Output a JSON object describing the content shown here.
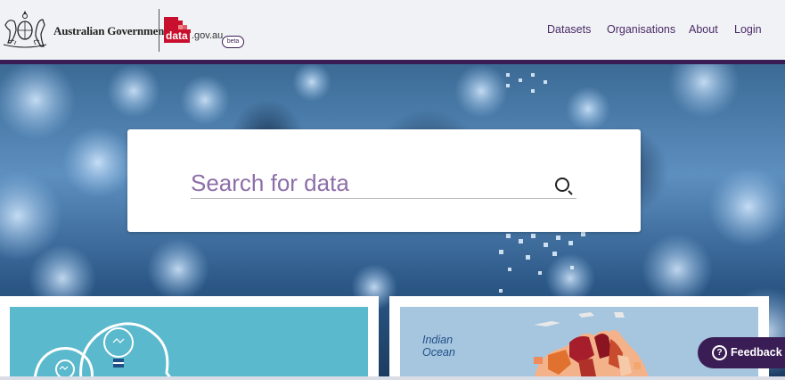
{
  "header": {
    "government_label": "Australian Government",
    "logo": {
      "data_text": "data",
      "domain_text": ".gov.au",
      "badge": "beta",
      "brand_color": "#c8102e"
    },
    "nav": [
      {
        "label": "Datasets"
      },
      {
        "label": "Organisations"
      },
      {
        "label": "About"
      },
      {
        "label": "Login"
      }
    ],
    "accent_color": "#3a1d54"
  },
  "search": {
    "placeholder": "Search for data",
    "value": "",
    "icon": "search-icon"
  },
  "cards": {
    "right_map_label": "Indian\nOcean"
  },
  "feedback": {
    "label": "Feedback",
    "icon": "question-circle-icon"
  }
}
